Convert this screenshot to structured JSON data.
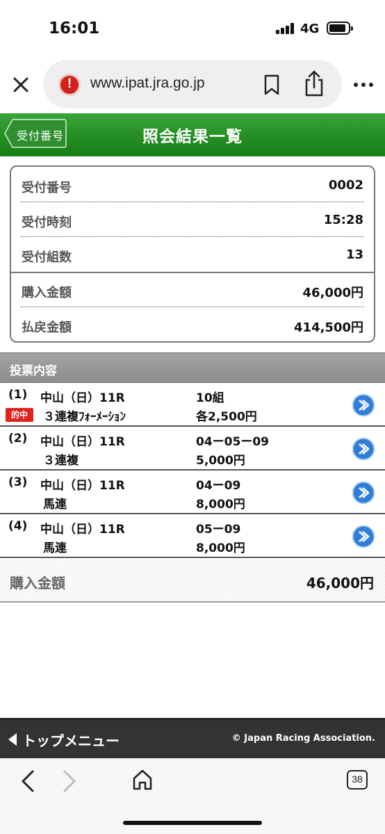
{
  "status_bar": {
    "time": "16:01",
    "network": "4G"
  },
  "browser": {
    "url": "www.ipat.jra.go.jp"
  },
  "header": {
    "back_label": "受付番号",
    "title": "照会結果一覧"
  },
  "summary": {
    "rows": [
      {
        "label": "受付番号",
        "value": "0002"
      },
      {
        "label": "受付時刻",
        "value": "15:28"
      },
      {
        "label": "受付組数",
        "value": "13"
      },
      {
        "label": "購入金額",
        "value": "46,000円"
      },
      {
        "label": "払戻金額",
        "value": "414,500円"
      }
    ]
  },
  "bets": {
    "section_title": "投票内容",
    "hit_label": "的中",
    "items": [
      {
        "num": "(1)",
        "race": "中山（日）11R",
        "type": "３連複ﾌｫｰﾒｰｼｮﾝ",
        "combo": "10組",
        "amount": "各2,500円",
        "hit": true
      },
      {
        "num": "(2)",
        "race": "中山（日）11R",
        "type": "３連複",
        "combo": "04ー05ー09",
        "amount": "5,000円",
        "hit": false
      },
      {
        "num": "(3)",
        "race": "中山（日）11R",
        "type": "馬連",
        "combo": "04ー09",
        "amount": "8,000円",
        "hit": false
      },
      {
        "num": "(4)",
        "race": "中山（日）11R",
        "type": "馬連",
        "combo": "05ー09",
        "amount": "8,000円",
        "hit": false
      }
    ]
  },
  "total": {
    "label": "購入金額",
    "value": "46,000円"
  },
  "footer": {
    "top_menu": "トップメニュー",
    "copyright": "© Japan Racing Association."
  },
  "nav": {
    "tab_count": "38"
  },
  "colors": {
    "header_green": "#1e8a1e",
    "hit_red": "#e0221b",
    "arrow_blue": "#2f7fd8"
  }
}
